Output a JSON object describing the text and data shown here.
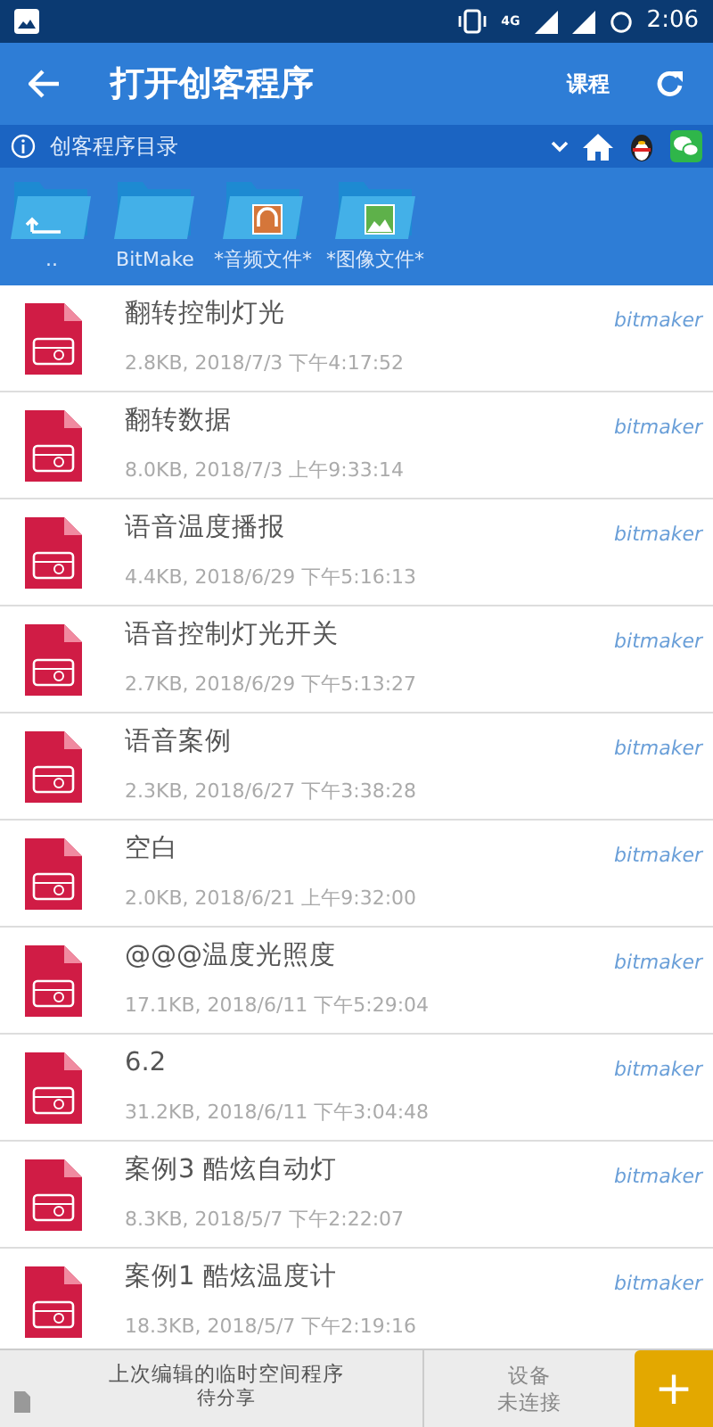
{
  "status_bar": {
    "network": "4G",
    "time": "2:06"
  },
  "app_bar": {
    "title": "打开创客程序",
    "action": "课程"
  },
  "path_bar": {
    "label": "创客程序目录"
  },
  "folders": [
    {
      "kind": "up",
      "label": ".."
    },
    {
      "kind": "plain",
      "label": "BitMake"
    },
    {
      "kind": "audio",
      "label": "*音频文件*"
    },
    {
      "kind": "image",
      "label": "*图像文件*"
    }
  ],
  "files": [
    {
      "name": "翻转控制灯光",
      "info": "2.8KB, 2018/7/3 下午4:17:52",
      "author": "bitmaker"
    },
    {
      "name": "翻转数据",
      "info": "8.0KB, 2018/7/3 上午9:33:14",
      "author": "bitmaker"
    },
    {
      "name": "语音温度播报",
      "info": "4.4KB, 2018/6/29 下午5:16:13",
      "author": "bitmaker"
    },
    {
      "name": "语音控制灯光开关",
      "info": "2.7KB, 2018/6/29 下午5:13:27",
      "author": "bitmaker"
    },
    {
      "name": "语音案例",
      "info": "2.3KB, 2018/6/27 下午3:38:28",
      "author": "bitmaker"
    },
    {
      "name": "空白",
      "info": "2.0KB, 2018/6/21 上午9:32:00",
      "author": "bitmaker"
    },
    {
      "name": "@@@温度光照度",
      "info": "17.1KB, 2018/6/11 下午5:29:04",
      "author": "bitmaker"
    },
    {
      "name": "6.2",
      "info": "31.2KB, 2018/6/11 下午3:04:48",
      "author": "bitmaker"
    },
    {
      "name": "案例3 酷炫自动灯",
      "info": "8.3KB, 2018/5/7 下午2:22:07",
      "author": "bitmaker"
    },
    {
      "name": "案例1 酷炫温度计",
      "info": "18.3KB, 2018/5/7 下午2:19:16",
      "author": "bitmaker"
    }
  ],
  "bottom_bar": {
    "temp_title": "上次编辑的临时空间程序",
    "temp_status": "待分享",
    "device_title": "设备",
    "device_status": "未连接",
    "add": "+"
  }
}
